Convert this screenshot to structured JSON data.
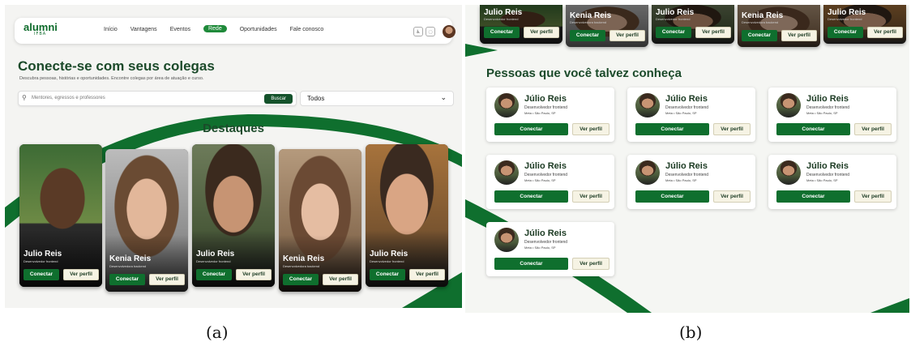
{
  "figure_a": {
    "caption": "(a)",
    "logo": {
      "name": "alumni",
      "sub": "IFBA"
    },
    "nav": [
      {
        "label": "Início",
        "active": false
      },
      {
        "label": "Vantagens",
        "active": false
      },
      {
        "label": "Eventos",
        "active": false
      },
      {
        "label": "Rede",
        "active": true
      },
      {
        "label": "Oportunidades",
        "active": false
      },
      {
        "label": "Fale conosco",
        "active": false
      }
    ],
    "header_icons": [
      "accessibility-icon",
      "notification-icon"
    ],
    "title": "Conecte-se com seus colegas",
    "subtitle": "Descubra pessoas, histórias e oportunidades. Encontre colegas por área de atuação e curso.",
    "search": {
      "placeholder": "Mentores, egressos e professores",
      "button": "Buscar"
    },
    "filter": {
      "selected": "Todos"
    },
    "highlights_title": "Destaques",
    "highlights": [
      {
        "name": "Julio Reis",
        "role": "Desenvolvedor frontend"
      },
      {
        "name": "Kenia Reis",
        "role": "Desenvolvedora backend"
      },
      {
        "name": "Julio Reis",
        "role": "Desenvolvedor frontend"
      },
      {
        "name": "Kenia Reis",
        "role": "Desenvolvedora backend"
      },
      {
        "name": "Julio Reis",
        "role": "Desenvolvedor frontend"
      }
    ],
    "connect_label": "Conectar",
    "profile_label": "Ver perfil"
  },
  "figure_b": {
    "caption": "(b)",
    "top_cards": [
      {
        "name": "Julio Reis",
        "role": "Desenvolvedor frontend"
      },
      {
        "name": "Kenia Reis",
        "role": "Desenvolvedora backend"
      },
      {
        "name": "Julio Reis",
        "role": "Desenvolvedor frontend"
      },
      {
        "name": "Kenia Reis",
        "role": "Desenvolvedora backend"
      },
      {
        "name": "Julio Reis",
        "role": "Desenvolvedor frontend"
      }
    ],
    "section_title": "Pessoas que você talvez conheça",
    "people": [
      {
        "name": "Júlio Reis",
        "role": "Desenvolvedor frontend",
        "location": "Meta • São Paulo, SP"
      },
      {
        "name": "Júlio Reis",
        "role": "Desenvolvedor frontend",
        "location": "Meta • São Paulo, SP"
      },
      {
        "name": "Júlio Reis",
        "role": "Desenvolvedor frontend",
        "location": "Meta • São Paulo, SP"
      },
      {
        "name": "Júlio Reis",
        "role": "Desenvolvedor frontend",
        "location": "Meta • São Paulo, SP"
      },
      {
        "name": "Júlio Reis",
        "role": "Desenvolvedor frontend",
        "location": "Meta • São Paulo, SP"
      },
      {
        "name": "Júlio Reis",
        "role": "Desenvolvedor frontend",
        "location": "Meta • São Paulo, SP"
      },
      {
        "name": "Júlio Reis",
        "role": "Desenvolvedor frontend",
        "location": "Meta • São Paulo, SP"
      }
    ],
    "connect_label": "Conectar",
    "profile_label": "Ver perfil"
  },
  "colors": {
    "brand_green": "#0f6f2e",
    "dark_green": "#1b4a2a",
    "cream": "#f6f3e4"
  }
}
